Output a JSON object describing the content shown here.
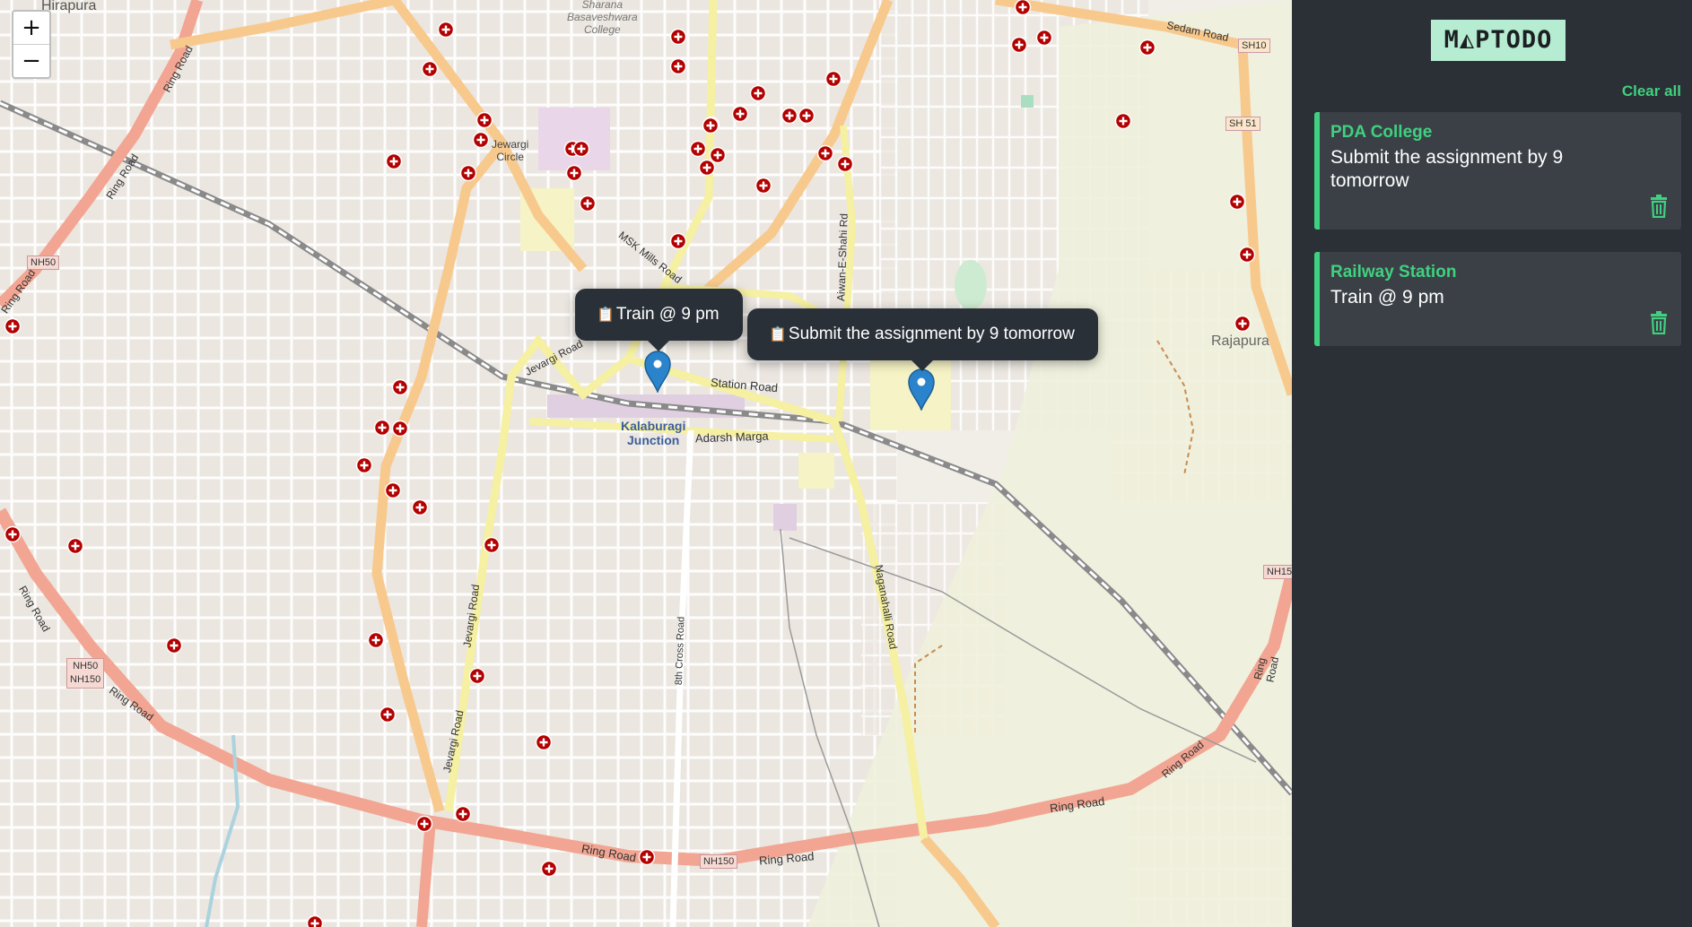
{
  "app": {
    "logo_text": "M◭PTODO",
    "clear_all_label": "Clear all"
  },
  "colors": {
    "accent": "#3fd17f",
    "sidebar_bg": "#2b3036",
    "card_bg": "#3b4047",
    "logo_bg": "#b6ecd1",
    "marker": "#2a83cb",
    "hospital": "#b30000",
    "popup_bg": "#2a3038"
  },
  "map": {
    "zoom_in_label": "+",
    "zoom_out_label": "−",
    "place_labels": {
      "hirapura": "Hirapura",
      "college_1": "Sharana",
      "college_2": "Basaveshwara",
      "college_3": "College",
      "jewargi_circle_1": "Jewargi",
      "jewargi_circle_2": "Circle",
      "rajapura": "Rajapura",
      "station_1": "Kalaburagi",
      "station_2": "Junction"
    },
    "road_labels": {
      "ring_road_nw": "Ring Road",
      "ring_road_w1": "Ring Road",
      "ring_road_w2": "Ring Road",
      "ring_road_sw1": "Ring Road",
      "ring_road_sw2": "Ring Road",
      "ring_road_s1": "Ring Road",
      "ring_road_s2": "Ring Road",
      "ring_road_s3": "Ring Road",
      "ring_road_se": "Ring Road",
      "ring_road_e": "Ring Road",
      "sedam_road": "Sedam Road",
      "msk_mills": "MSK Mills Road",
      "jewargi_road_n": "Jevargi Road",
      "jewargi_road_s": "Jevargi Road",
      "jevargi_road_s2": "Jevargi Road",
      "station_road": "Station Road",
      "adarsh_marga": "Adarsh Marga",
      "aiwan_e_shahi": "Aiwan-E-Shahi Rd",
      "cross_road": "8th Cross Road",
      "naganahalli": "Naganahalli Road"
    },
    "shields": {
      "nh50_w": "NH50",
      "nh50_sw": "NH50",
      "nh150_sw": "NH150",
      "nh150_s": "NH150",
      "sh10": "SH10",
      "sh51": "SH 51",
      "nh15_e": "NH15"
    },
    "popups": [
      {
        "icon": "clipboard-icon",
        "clip": "📋",
        "text": "Train @ 9 pm"
      },
      {
        "icon": "clipboard-icon",
        "clip": "📋",
        "text": "Submit the assignment by 9 tomorrow"
      }
    ]
  },
  "todos": [
    {
      "title": "PDA College",
      "text": "Submit the assignment by 9 tomorrow"
    },
    {
      "title": "Railway Station",
      "text": "Train @ 9 pm"
    }
  ]
}
